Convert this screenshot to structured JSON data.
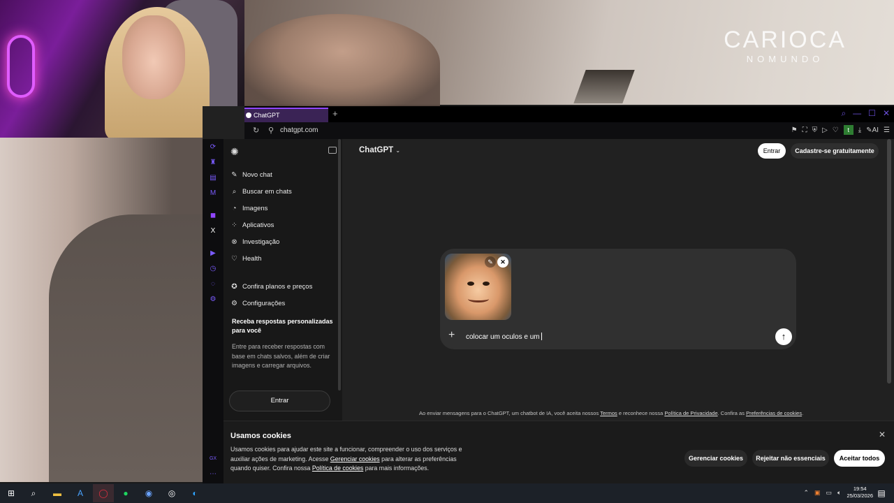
{
  "overlay": {
    "logo_line1": "CARIOCA",
    "logo_line2": "NOMUNDO"
  },
  "browser": {
    "tab_title": "ChatGPT",
    "url": "chatgpt.com",
    "extension_letter": "t",
    "ai_label": "AI"
  },
  "sidebar": {
    "items": [
      {
        "label": "Novo chat",
        "icon": "✎"
      },
      {
        "label": "Buscar em chats",
        "icon": "⌕"
      },
      {
        "label": "Imagens",
        "icon": "◔"
      },
      {
        "label": "Aplicativos",
        "icon": "⁘"
      },
      {
        "label": "Investigação",
        "icon": "⊗"
      },
      {
        "label": "Health",
        "icon": "♡"
      },
      {
        "label": "Confira planos e preços",
        "icon": "✪"
      },
      {
        "label": "Configurações",
        "icon": "⚙"
      }
    ],
    "promo_title": "Receba respostas personalizadas para você",
    "promo_desc": "Entre para receber respostas com base em chats salvos, além de criar imagens e carregar arquivos.",
    "login_label": "Entrar"
  },
  "header": {
    "model": "ChatGPT",
    "login": "Entrar",
    "signup": "Cadastre-se gratuitamente"
  },
  "composer": {
    "prompt_text": "colocar um oculos e um"
  },
  "disclaimer": {
    "prefix": "Ao enviar mensagens para o ChatGPT, um chatbot de IA, você aceita nossos ",
    "terms": "Termos",
    "mid": " e reconhece nossa ",
    "privacy": "Política de Privacidade",
    "mid2": ". Confira as ",
    "cookies": "Preferências de cookies",
    "end": "."
  },
  "cookies": {
    "title": "Usamos cookies",
    "body_1": "Usamos cookies para ajudar este site a funcionar, compreender o uso dos serviços e auxiliar ações de marketing. Acesse ",
    "manage_link": "Gerenciar cookies",
    "body_2": " para alterar as preferências quando quiser. Confira nossa ",
    "policy_link": "Política de cookies",
    "body_3": " para mais informações.",
    "manage": "Gerenciar cookies",
    "reject": "Rejeitar não essenciais",
    "accept": "Aceitar todos"
  },
  "taskbar": {
    "time": "19:54",
    "date": "25/03/2026"
  },
  "colors": {
    "accent": "#9146ff",
    "bg": "#212121",
    "sidebar": "#181818"
  }
}
